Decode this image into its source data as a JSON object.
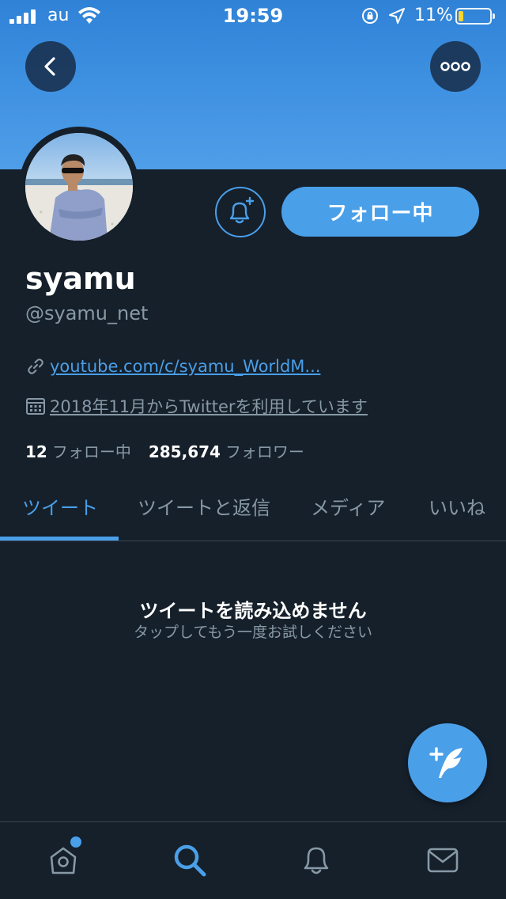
{
  "status_bar": {
    "carrier": "au",
    "time": "19:59",
    "battery_percent": "11%",
    "battery_level": 0.11,
    "battery_color": "#ffd52e"
  },
  "header": {
    "back_icon": "chevron-left-icon",
    "more_icon": "more-horizontal-icon",
    "banner_color": "#3d8fe0"
  },
  "profile": {
    "name": "syamu",
    "handle": "@syamu_net",
    "link": "youtube.com/c/syamu_WorldM...",
    "joined": "2018年11月からTwitterを利用しています",
    "following_count": "12",
    "following_label": "フォロー中",
    "followers_count": "285,674",
    "followers_label": "フォロワー",
    "follow_button_label": "フォロー中",
    "notification_icon": "bell-plus-icon"
  },
  "tabs": [
    {
      "label": "ツイート",
      "active": true
    },
    {
      "label": "ツイートと返信",
      "active": false
    },
    {
      "label": "メディア",
      "active": false
    },
    {
      "label": "いいね",
      "active": false
    }
  ],
  "timeline": {
    "error_title": "ツイートを読み込めません",
    "error_subtitle": "タップしてもう一度お試しください"
  },
  "compose": {
    "icon": "compose-tweet-icon"
  },
  "bottom_nav": [
    {
      "icon": "home-icon",
      "has_badge": true
    },
    {
      "icon": "search-icon",
      "active": true
    },
    {
      "icon": "notifications-icon"
    },
    {
      "icon": "messages-icon"
    }
  ],
  "colors": {
    "accent": "#4a9fe9",
    "background": "#15202b",
    "secondary_text": "#8899a6"
  }
}
